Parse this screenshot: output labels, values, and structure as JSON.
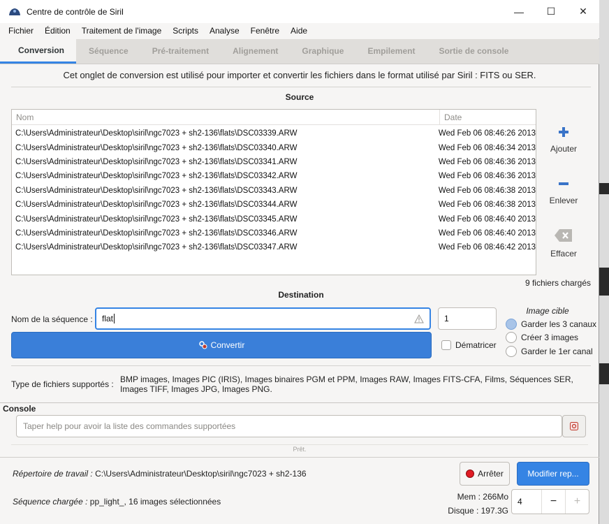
{
  "window": {
    "title": "Centre de contrôle de Siril",
    "controls": {
      "minimize": "—",
      "maximize": "☐",
      "close": "✕"
    }
  },
  "menu": [
    "Fichier",
    "Édition",
    "Traitement de l'image",
    "Scripts",
    "Analyse",
    "Fenêtre",
    "Aide"
  ],
  "tabs": [
    "Conversion",
    "Séquence",
    "Pré-traitement",
    "Alignement",
    "Graphique",
    "Empilement",
    "Sortie de console"
  ],
  "intro": "Cet onglet de conversion est utilisé pour importer et convertir les fichiers dans le format utilisé par Siril : FITS ou SER.",
  "source": {
    "title": "Source",
    "col_name": "Nom",
    "col_date": "Date",
    "files": [
      {
        "name": "C:\\Users\\Administrateur\\Desktop\\siril\\ngc7023 + sh2-136\\flats\\DSC03339.ARW",
        "date": "Wed Feb 06 08:46:26 2013"
      },
      {
        "name": "C:\\Users\\Administrateur\\Desktop\\siril\\ngc7023 + sh2-136\\flats\\DSC03340.ARW",
        "date": "Wed Feb 06 08:46:34 2013"
      },
      {
        "name": "C:\\Users\\Administrateur\\Desktop\\siril\\ngc7023 + sh2-136\\flats\\DSC03341.ARW",
        "date": "Wed Feb 06 08:46:36 2013"
      },
      {
        "name": "C:\\Users\\Administrateur\\Desktop\\siril\\ngc7023 + sh2-136\\flats\\DSC03342.ARW",
        "date": "Wed Feb 06 08:46:36 2013"
      },
      {
        "name": "C:\\Users\\Administrateur\\Desktop\\siril\\ngc7023 + sh2-136\\flats\\DSC03343.ARW",
        "date": "Wed Feb 06 08:46:38 2013"
      },
      {
        "name": "C:\\Users\\Administrateur\\Desktop\\siril\\ngc7023 + sh2-136\\flats\\DSC03344.ARW",
        "date": "Wed Feb 06 08:46:38 2013"
      },
      {
        "name": "C:\\Users\\Administrateur\\Desktop\\siril\\ngc7023 + sh2-136\\flats\\DSC03345.ARW",
        "date": "Wed Feb 06 08:46:40 2013"
      },
      {
        "name": "C:\\Users\\Administrateur\\Desktop\\siril\\ngc7023 + sh2-136\\flats\\DSC03346.ARW",
        "date": "Wed Feb 06 08:46:40 2013"
      },
      {
        "name": "C:\\Users\\Administrateur\\Desktop\\siril\\ngc7023 + sh2-136\\flats\\DSC03347.ARW",
        "date": "Wed Feb 06 08:46:42 2013"
      }
    ],
    "add": "Ajouter",
    "remove": "Enlever",
    "clear": "Effacer",
    "loaded": "9 fichiers chargés"
  },
  "destination": {
    "title": "Destination",
    "seq_label": "Nom de la séquence :",
    "seq_value": "flat",
    "start_index": "1",
    "convert": "Convertir",
    "debayer": "Dématricer",
    "target_title": "Image cible",
    "target_options": [
      "Garder les 3 canaux",
      "Créer 3 images",
      "Garder le 1er canal"
    ],
    "target_selected": 0
  },
  "supported": {
    "label": "Type de fichiers supportés :",
    "text": "BMP images, Images PIC (IRIS), Images binaires PGM et PPM, Images RAW, Images FITS-CFA, Films, Séquences SER, Images TIFF, Images JPG, Images PNG."
  },
  "console": {
    "title": "Console",
    "placeholder": "Taper help pour avoir la liste des commandes supportées",
    "status": "Prêt."
  },
  "footer": {
    "workdir_label": "Répertoire de travail :",
    "workdir_value": "C:\\Users\\Administrateur\\Desktop\\siril\\ngc7023 + sh2-136",
    "seq_label": "Séquence chargée :",
    "seq_value": "pp_light_, 16 images sélectionnées",
    "stop": "Arrêter",
    "modify": "Modifier rep...",
    "mem": "Mem : 266Mo",
    "disk": "Disque : 197.3G",
    "threads": "4",
    "minus": "−",
    "plus": "+"
  },
  "colors": {
    "accent": "#3584e4",
    "stop": "#e01b24"
  }
}
